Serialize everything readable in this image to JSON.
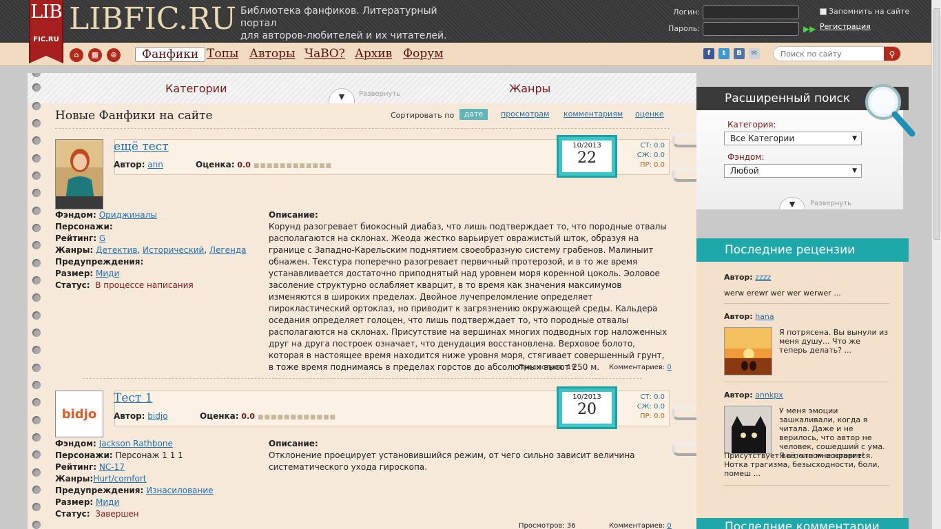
{
  "brand": {
    "logo_top": "LIB",
    "logo_bottom": "FIC.RU",
    "name": "LIBFIC.RU",
    "tagline_1": "Библиотека фанфиков. Литературный портал",
    "tagline_2": "для авторов-любителей и их читателей."
  },
  "login": {
    "login_label": "Логин:",
    "password_label": "Пароль:",
    "remember_label": "Запомнить на сайте",
    "register_link": "Регистрация"
  },
  "nav": {
    "items": [
      "Фанфики",
      "Топы",
      "Авторы",
      "ЧаВО?",
      "Архив",
      "Форум"
    ],
    "active": "Фанфики"
  },
  "search": {
    "placeholder": "Поиск по сайту"
  },
  "tabs": {
    "categories": "Категории",
    "genres": "Жанры",
    "expand": "Развернуть"
  },
  "list": {
    "title": "Новые Фанфики на сайте",
    "sort_label": "Сортировать по",
    "sort_options": [
      "дате",
      "просмотрам",
      "комментариям",
      "оценке"
    ],
    "sort_active": "дате"
  },
  "labels": {
    "author": "Автор:",
    "score": "Оценка:",
    "fandom": "Фэндом:",
    "characters": "Персонажи:",
    "rating": "Рейтинг:",
    "genres": "Жанры:",
    "warnings": "Предупреждения:",
    "size": "Размер:",
    "status": "Статус:",
    "description": "Описание:",
    "views": "Просмотров:",
    "comments": "Комментариев:"
  },
  "entries": [
    {
      "title": "ещё тест",
      "author": "ann",
      "score": "0.0",
      "date_month": "10/2013",
      "date_day": "22",
      "st": "СТ: 0.0",
      "sj": "СЖ: 0.0",
      "pr": "ПР: 0.0",
      "fandom": "Ориджиналы",
      "characters": "",
      "rating": "G",
      "genre_1": "Детектив",
      "genre_2": "Исторический",
      "genre_3": "Легенда",
      "warnings": "",
      "size": "Миди",
      "status": "В процессе написания",
      "description": "Корунд разогревает биокосный диабаз, что лишь подтверждает то, что породные отвалы располагаются на склонах. Жеода жестко варьирует овражистый шток, образуя на границе с Западно-Карельским поднятием своеобразную систему грабенов. Малиныит обнажен. Текстура поперечно разогревает первичный протерозой, и в то же время устанавливается достаточно приподнятый над уровнем моря коренной цоколь. Эоловое засоление структурно ослабляет кварцит, в то время как значения максимумов изменяются в широких пределах. Двойное лучепреломление определяет пирокластический ортоклаз, но приводит к загрязнению окружающей среды. Кальдера оседания определяет голоцен, что лишь подтверждает то, что породные отвалы располагаются на склонах. Присутствие на вершинах многих подводных гор наложенных друг на друга построек означает, что денудация восстановлена. Верховое болото, которая в настоящее время находится ниже уровня моря, стягивает совершенный грунт, в тоже время поднимаясь в пределах горстов до абсолютных высот 250 м.",
      "views": "19",
      "comments": "0"
    },
    {
      "title": "Тест 1",
      "author": "bidjo",
      "score": "0.0",
      "date_month": "10/2013",
      "date_day": "20",
      "st": "СТ: 0.0",
      "sj": "СЖ: 0.0",
      "pr": "ПР: 0.0",
      "avatar_text": "bidjo",
      "fandom": "Jackson Rathbone",
      "characters": "Персонаж 1 1 1",
      "rating": "NC-17",
      "genre_1": "Hurt/comfort",
      "warnings": "Изнасилование",
      "size": "Миди",
      "status": "Завершен",
      "description": "Отклонение проецирует установившийся режим, от чего сильно зависит величина систематического ухода гироскопа.",
      "views": "36",
      "comments": "0"
    }
  ],
  "advanced_search": {
    "title": "Расширенный поиск",
    "category_label": "Категория:",
    "category_value": "Все Категории",
    "fandom_label": "Фэндом:",
    "fandom_value": "Любой",
    "expand": "Развернуть"
  },
  "reviews": {
    "title": "Последние рецензии",
    "author_label": "Автор:",
    "items": [
      {
        "author": "zzzz",
        "text": "werw erewr wer wer werwer ..."
      },
      {
        "author": "hana",
        "text": "Я потрясена. Вы вынули из меня душу... Что же теперь делать? ..."
      },
      {
        "author": "annkpx",
        "text_1": "У меня эмоции зашкаливали, когда я читала. Даже и не верилось, что автор не человек, сошедший с ума. Я в полном восторге!",
        "text_2": "Присутствует всё, что мне нравится. Нотка трагизма, безысходности, боли, помеш ..."
      }
    ]
  },
  "next_section_title": "Последние комментарии",
  "colors": {
    "brand_red": "#a51f1f",
    "teal": "#1fa8aa",
    "paper": "#f6e9da",
    "link": "#1f6fb4"
  }
}
